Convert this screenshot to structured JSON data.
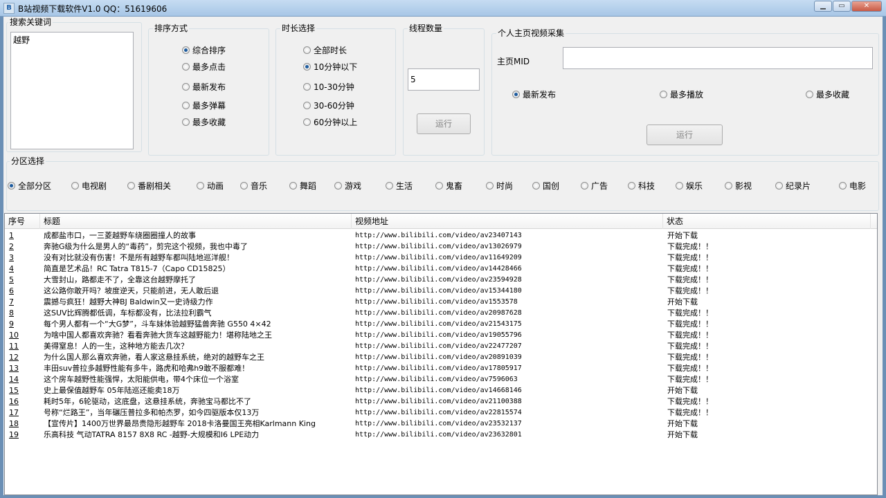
{
  "window": {
    "title": "B站视频下载软件V1.0 QQ：51619606",
    "icon_glyph": "B",
    "min_glyph": "▁",
    "max_glyph": "▭",
    "close_glyph": "✕"
  },
  "search": {
    "label": "搜索关键词",
    "value": "越野"
  },
  "sort": {
    "label": "排序方式",
    "options": [
      "综合排序",
      "最多点击",
      "最新发布",
      "最多弹幕",
      "最多收藏"
    ],
    "selected": 0
  },
  "duration": {
    "label": "时长选择",
    "options": [
      "全部时长",
      "10分钟以下",
      "10-30分钟",
      "30-60分钟",
      "60分钟以上"
    ],
    "selected": 1
  },
  "threads": {
    "label": "线程数量",
    "value": "5",
    "run_label": "运行"
  },
  "profile": {
    "label": "个人主页视频采集",
    "mid_label": "主页MID",
    "mid_value": "",
    "options": [
      "最新发布",
      "最多播放",
      "最多收藏"
    ],
    "selected": 0,
    "run_label": "运行"
  },
  "category": {
    "label": "分区选择",
    "options": [
      "全部分区",
      "电视剧",
      "番剧相关",
      "动画",
      "音乐",
      "舞蹈",
      "游戏",
      "生活",
      "鬼畜",
      "时尚",
      "国创",
      "广告",
      "科技",
      "娱乐",
      "影视",
      "纪录片",
      "电影"
    ],
    "selected": 0
  },
  "table": {
    "columns": [
      "序号",
      "标题",
      "视频地址",
      "状态"
    ],
    "rows": [
      {
        "no": "1",
        "title": "成都盐市口，一三菱越野车绕圈圈撞人的故事",
        "url": "http://www.bilibili.com/video/av23407143",
        "status": "开始下载"
      },
      {
        "no": "2",
        "title": "奔驰G级为什么是男人的“毒药”，剪完这个视频，我也中毒了",
        "url": "http://www.bilibili.com/video/av13026979",
        "status": "下载完成！！"
      },
      {
        "no": "3",
        "title": "没有对比就没有伤害！不是所有越野车都叫陆地巡洋舰！",
        "url": "http://www.bilibili.com/video/av11649209",
        "status": "下载完成！！"
      },
      {
        "no": "4",
        "title": "简直是艺术品！RC Tatra T815-7（Capo CD15825）",
        "url": "http://www.bilibili.com/video/av14428466",
        "status": "下载完成！！"
      },
      {
        "no": "5",
        "title": "大雪封山，路都走不了，全靠这台越野摩托了",
        "url": "http://www.bilibili.com/video/av23594928",
        "status": "下载完成！！"
      },
      {
        "no": "6",
        "title": "这公路你敢开吗？坡度逆天，只能前进，无人敢后退",
        "url": "http://www.bilibili.com/video/av15344180",
        "status": "下载完成！！"
      },
      {
        "no": "7",
        "title": "震撼与疯狂！越野大神BJ Baldwin又一史诗级力作",
        "url": "http://www.bilibili.com/video/av1553578",
        "status": "开始下载"
      },
      {
        "no": "8",
        "title": "这SUV比辉腾都低调，车标都没有，比法拉利霸气",
        "url": "http://www.bilibili.com/video/av20987628",
        "status": "下载完成！！"
      },
      {
        "no": "9",
        "title": "每个男人都有一个“大G梦”，斗车妹体验越野猛兽奔驰 G550 4×42",
        "url": "http://www.bilibili.com/video/av21543175",
        "status": "下载完成！！"
      },
      {
        "no": "10",
        "title": "为啥中国人都喜欢奔驰？看看奔驰大货车这越野能力！堪称陆地之王",
        "url": "http://www.bilibili.com/video/av19055796",
        "status": "下载完成！！"
      },
      {
        "no": "11",
        "title": "美得窒息！人的一生，这种地方能去几次？",
        "url": "http://www.bilibili.com/video/av22477207",
        "status": "下载完成！！"
      },
      {
        "no": "12",
        "title": "为什么国人那么喜欢奔驰，看人家这悬挂系统，绝对的越野车之王",
        "url": "http://www.bilibili.com/video/av20891039",
        "status": "下载完成！！"
      },
      {
        "no": "13",
        "title": "丰田suv普拉多越野性能有多牛，路虎和哈弗h9敢不服都难！",
        "url": "http://www.bilibili.com/video/av17805917",
        "status": "下载完成！！"
      },
      {
        "no": "14",
        "title": "这个房车越野性能强悍，太阳能供电，带4个床位一个浴室",
        "url": "http://www.bilibili.com/video/av7596063",
        "status": "下载完成！！"
      },
      {
        "no": "15",
        "title": "史上最保值越野车 05年陆巡还能卖18万",
        "url": "http://www.bilibili.com/video/av14668146",
        "status": "开始下载"
      },
      {
        "no": "16",
        "title": "耗时5年，6轮驱动，这底盘，这悬挂系统，奔驰宝马都比不了",
        "url": "http://www.bilibili.com/video/av21100388",
        "status": "下载完成！！"
      },
      {
        "no": "17",
        "title": "号称“烂路王”，当年碾压普拉多和帕杰罗，如今四驱版本仅13万",
        "url": "http://www.bilibili.com/video/av22815574",
        "status": "下载完成！！"
      },
      {
        "no": "18",
        "title": "【宣传片】1400万世界最昂贵隐形越野车 2018卡洛曼国王亮相Karlmann King",
        "url": "http://www.bilibili.com/video/av23532137",
        "status": "开始下载"
      },
      {
        "no": "19",
        "title": "乐高科技 气动TATRA 8157 8X8 RC -越野-大规模和I6 LPE动力",
        "url": "http://www.bilibili.com/video/av23632801",
        "status": "开始下载"
      }
    ]
  }
}
